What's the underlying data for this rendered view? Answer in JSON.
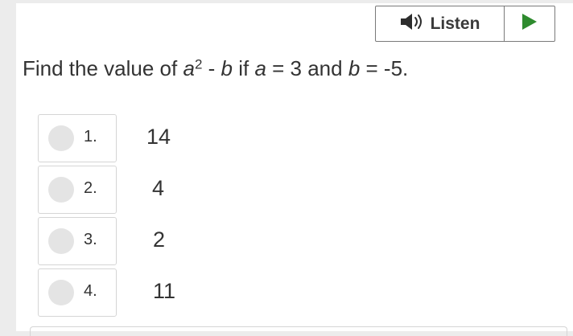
{
  "toolbar": {
    "listen_label": "Listen",
    "speaker_icon": "speaker-icon",
    "play_icon": "play-icon",
    "play_color": "#2e8b2e"
  },
  "question": {
    "prefix": "Find the value of ",
    "var_a": "a",
    "exponent": "2",
    "minus": " - ",
    "var_b": "b",
    "if_text": " if ",
    "var_a2": "a",
    "eq_a": " = 3 and ",
    "var_b2": "b",
    "eq_b": " = -5."
  },
  "options": [
    {
      "number": "1.",
      "value": "14"
    },
    {
      "number": "2.",
      "value": "4"
    },
    {
      "number": "3.",
      "value": "2"
    },
    {
      "number": "4.",
      "value": "11"
    }
  ]
}
